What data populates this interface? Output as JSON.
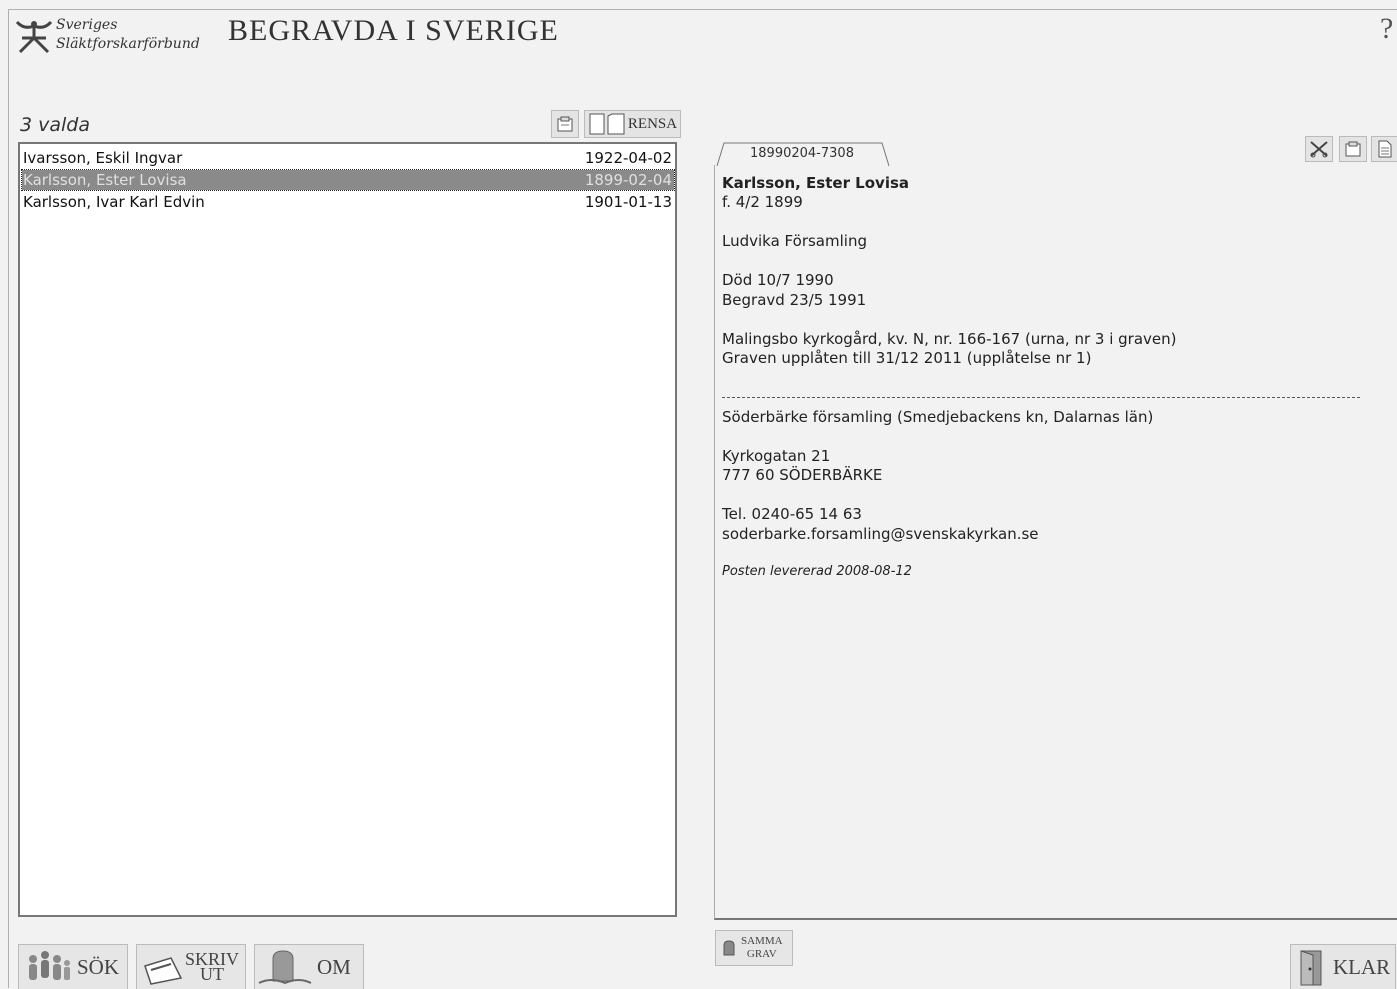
{
  "header": {
    "org_line1": "Sveriges",
    "org_line2": "Släktforskarförbund",
    "title": "BEGRAVDA I SVERIGE",
    "help": "?"
  },
  "list": {
    "count_label": "3 valda",
    "rensa_label": "RENSA",
    "rows": [
      {
        "name": "Ivarsson, Eskil Ingvar",
        "date": "1922-04-02"
      },
      {
        "name": "Karlsson, Ester Lovisa",
        "date": "1899-02-04"
      },
      {
        "name": "Karlsson, Ivar Karl Edvin",
        "date": "1901-01-13"
      }
    ]
  },
  "detail": {
    "tab_label": "18990204-7308",
    "name": "Karlsson, Ester Lovisa",
    "born": "f. 4/2 1899",
    "parish": "Ludvika Församling",
    "died": "Död 10/7 1990",
    "buried": "Begravd 23/5 1991",
    "grave": "Malingsbo kyrkogård, kv. N, nr. 166-167 (urna, nr 3 i graven)",
    "lease": "Graven upplåten till 31/12 2011 (upplåtelse nr 1)",
    "contact_parish": "Söderbärke församling (Smedjebackens kn, Dalarnas län)",
    "street": "Kyrkogatan 21",
    "postal": "777 60  SÖDERBÄRKE",
    "phone": "Tel. 0240-65 14 63",
    "email": "soderbarke.forsamling@svenskakyrkan.se",
    "delivered": "Posten levererad 2008-08-12"
  },
  "buttons": {
    "sok": "SÖK",
    "skriv_line1": "SKRIV",
    "skriv_line2": "UT",
    "om": "OM",
    "samma_line1": "SAMMA",
    "samma_line2": "GRAV",
    "klar": "KLAR"
  },
  "colors": {
    "background": "#f2f2f2",
    "selection": "#8a8a8a"
  }
}
